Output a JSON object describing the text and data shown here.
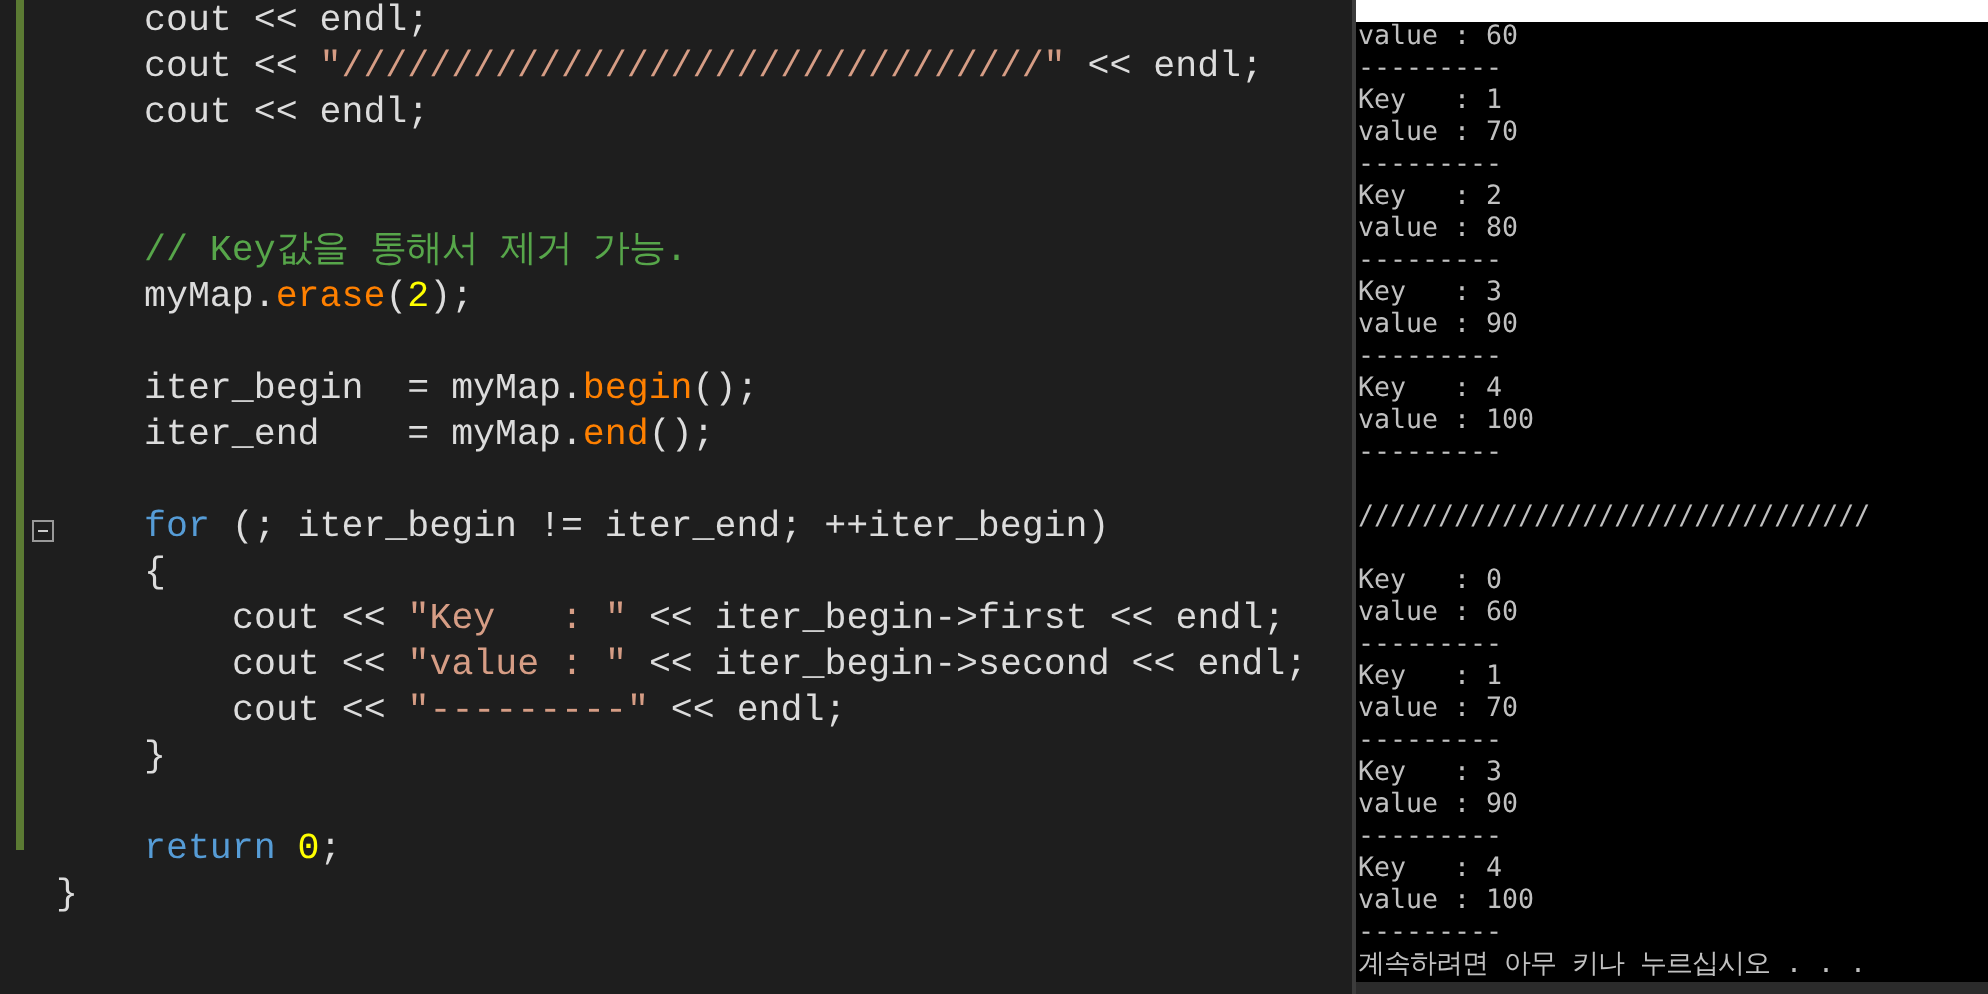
{
  "editor": {
    "function_body": [
      {
        "kind": "code",
        "tokens": [
          {
            "kind": "plain",
            "text": "cout << endl;"
          }
        ]
      },
      {
        "kind": "code",
        "tokens": [
          {
            "kind": "plain",
            "text": "cout << "
          },
          {
            "kind": "string",
            "text": "\"////////////////////////////////\""
          },
          {
            "kind": "plain",
            "text": " << endl;"
          }
        ]
      },
      {
        "kind": "code",
        "tokens": [
          {
            "kind": "plain",
            "text": "cout << endl;"
          }
        ]
      },
      {
        "kind": "blank"
      },
      {
        "kind": "blank"
      },
      {
        "kind": "code",
        "tokens": [
          {
            "kind": "comment",
            "text": "// Key값을 통해서 제거 가능."
          }
        ]
      },
      {
        "kind": "code",
        "tokens": [
          {
            "kind": "plain",
            "text": "myMap."
          },
          {
            "kind": "func",
            "text": "erase"
          },
          {
            "kind": "plain",
            "text": "("
          },
          {
            "kind": "number",
            "text": "2"
          },
          {
            "kind": "plain",
            "text": ");"
          }
        ]
      },
      {
        "kind": "blank"
      },
      {
        "kind": "code",
        "tokens": [
          {
            "kind": "plain",
            "text": "iter_begin  = myMap."
          },
          {
            "kind": "func",
            "text": "begin"
          },
          {
            "kind": "plain",
            "text": "();"
          }
        ]
      },
      {
        "kind": "code",
        "tokens": [
          {
            "kind": "plain",
            "text": "iter_end    = myMap."
          },
          {
            "kind": "func",
            "text": "end"
          },
          {
            "kind": "plain",
            "text": "();"
          }
        ]
      },
      {
        "kind": "blank"
      },
      {
        "kind": "code",
        "foldable": true,
        "tokens": [
          {
            "kind": "keyword",
            "text": "for"
          },
          {
            "kind": "plain",
            "text": " (; iter_begin != iter_end; ++iter_begin)"
          }
        ]
      },
      {
        "kind": "code",
        "tokens": [
          {
            "kind": "plain",
            "text": "{"
          }
        ],
        "children": [
          {
            "kind": "code",
            "tokens": [
              {
                "kind": "plain",
                "text": "cout << "
              },
              {
                "kind": "string",
                "text": "\"Key   : \""
              },
              {
                "kind": "plain",
                "text": " << iter_begin->first << endl;"
              }
            ]
          },
          {
            "kind": "code",
            "tokens": [
              {
                "kind": "plain",
                "text": "cout << "
              },
              {
                "kind": "string",
                "text": "\"value : \""
              },
              {
                "kind": "plain",
                "text": " << iter_begin->second << endl;"
              }
            ]
          },
          {
            "kind": "code",
            "tokens": [
              {
                "kind": "plain",
                "text": "cout << "
              },
              {
                "kind": "string",
                "text": "\"---------\""
              },
              {
                "kind": "plain",
                "text": " << endl;"
              }
            ]
          }
        ]
      },
      {
        "kind": "code",
        "tokens": [
          {
            "kind": "plain",
            "text": "}"
          }
        ]
      },
      {
        "kind": "blank"
      },
      {
        "kind": "code",
        "tokens": [
          {
            "kind": "keyword",
            "text": "return"
          },
          {
            "kind": "number",
            "text": " 0"
          },
          {
            "kind": "plain",
            "text": ";"
          }
        ]
      }
    ],
    "closing": {
      "kind": "code",
      "tokens": [
        {
          "kind": "plain",
          "text": "}"
        }
      ]
    }
  },
  "console": {
    "lines": [
      {
        "kind": "text",
        "text": "value : 60"
      },
      {
        "kind": "text",
        "text": "---------"
      },
      {
        "kind": "text",
        "text": "Key   : 1"
      },
      {
        "kind": "text",
        "text": "value : 70"
      },
      {
        "kind": "text",
        "text": "---------"
      },
      {
        "kind": "text",
        "text": "Key   : 2"
      },
      {
        "kind": "text",
        "text": "value : 80"
      },
      {
        "kind": "text",
        "text": "---------"
      },
      {
        "kind": "text",
        "text": "Key   : 3"
      },
      {
        "kind": "text",
        "text": "value : 90"
      },
      {
        "kind": "text",
        "text": "---------"
      },
      {
        "kind": "text",
        "text": "Key   : 4"
      },
      {
        "kind": "text",
        "text": "value : 100"
      },
      {
        "kind": "text",
        "text": "---------"
      },
      {
        "kind": "blank"
      },
      {
        "kind": "text",
        "text": "////////////////////////////////"
      },
      {
        "kind": "blank"
      },
      {
        "kind": "text",
        "text": "Key   : 0"
      },
      {
        "kind": "text",
        "text": "value : 60"
      },
      {
        "kind": "text",
        "text": "---------"
      },
      {
        "kind": "text",
        "text": "Key   : 1"
      },
      {
        "kind": "text",
        "text": "value : 70"
      },
      {
        "kind": "text",
        "text": "---------"
      },
      {
        "kind": "text",
        "text": "Key   : 3"
      },
      {
        "kind": "text",
        "text": "value : 90"
      },
      {
        "kind": "text",
        "text": "---------"
      },
      {
        "kind": "text",
        "text": "Key   : 4"
      },
      {
        "kind": "text",
        "text": "value : 100"
      },
      {
        "kind": "text",
        "text": "---------"
      },
      {
        "kind": "text",
        "text": "계속하려면 아무 키나 누르십시오 . . ."
      }
    ]
  }
}
